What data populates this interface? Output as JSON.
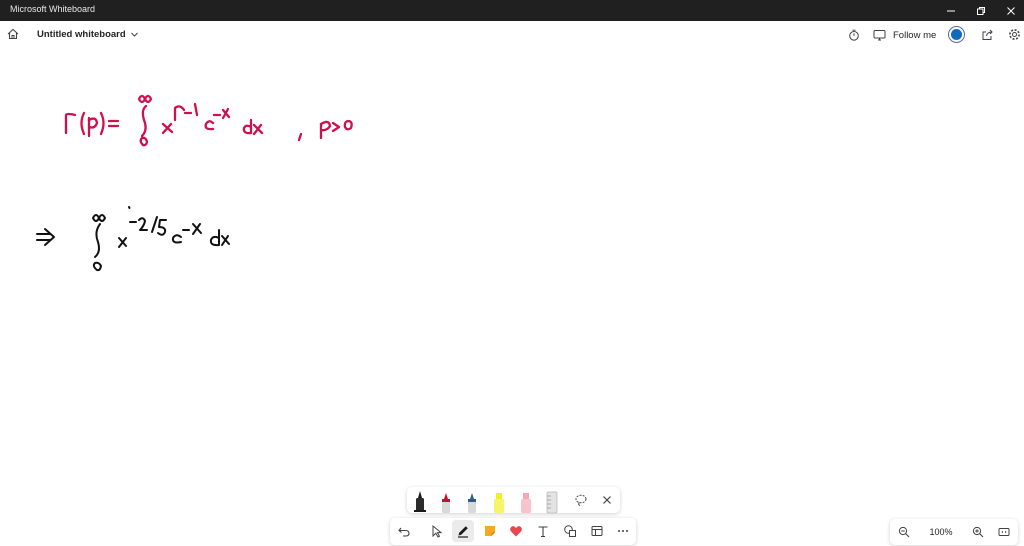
{
  "window": {
    "title": "Microsoft Whiteboard"
  },
  "header": {
    "board_name": "Untitled whiteboard",
    "follow_label": "Follow me"
  },
  "colors": {
    "ink": "#d0104c",
    "ink_dark": "#111111",
    "accent": "#0f6cbd",
    "titlebar": "#202020"
  },
  "toolbar": {
    "pens": [
      {
        "name": "black-pen",
        "color": "#1a1a1a"
      },
      {
        "name": "red-pen",
        "color": "#c8102e"
      },
      {
        "name": "blue-pen",
        "color": "#2f5d8a"
      },
      {
        "name": "yellow-highlighter",
        "color": "#f2f21a"
      },
      {
        "name": "pink-highlighter",
        "color": "#f4a7b9"
      },
      {
        "name": "ruler",
        "color": "#c9c9c9"
      }
    ],
    "tools": [
      "undo-icon",
      "select-icon",
      "pen-icon",
      "sticky-note-icon",
      "reaction-icon",
      "text-icon",
      "shapes-icon",
      "templates-icon",
      "more-icon"
    ]
  },
  "zoom": {
    "level": "100%"
  }
}
